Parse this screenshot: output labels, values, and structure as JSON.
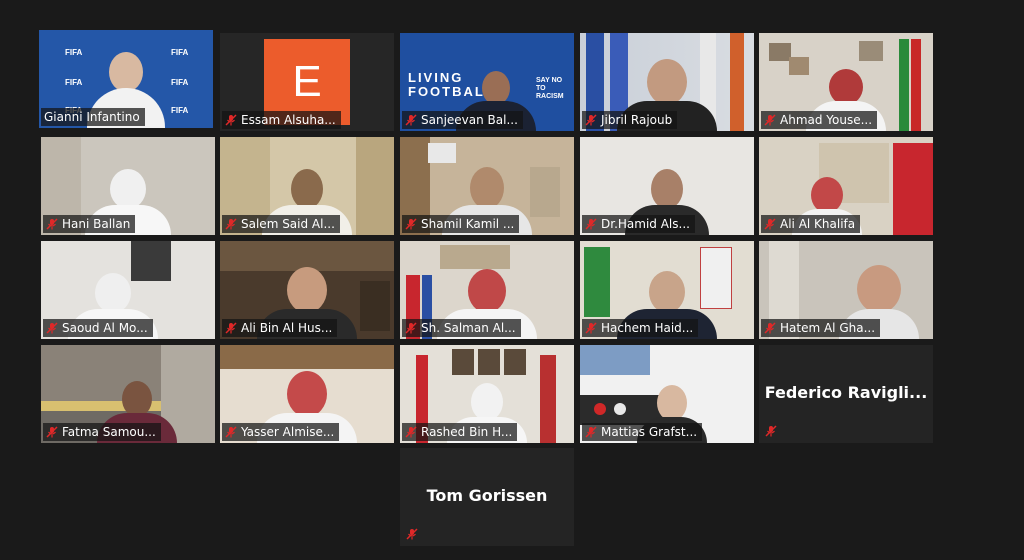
{
  "meeting": {
    "participants": [
      {
        "name": "Gianni Infantino",
        "muted": false,
        "speaking": true
      },
      {
        "name": "Essam Alsuha...",
        "muted": true,
        "avatar_letter": "E",
        "avatar_color": "#ec5c2c"
      },
      {
        "name": "Sanjeevan Bal...",
        "muted": true
      },
      {
        "name": "Jibril Rajoub",
        "muted": true
      },
      {
        "name": "Ahmad Youse...",
        "muted": true
      },
      {
        "name": "Hani Ballan",
        "muted": true
      },
      {
        "name": "Salem Said Al...",
        "muted": true
      },
      {
        "name": "Shamil Kamil ...",
        "muted": true
      },
      {
        "name": "Dr.Hamid Als...",
        "muted": true
      },
      {
        "name": "Ali Al Khalifa",
        "muted": true
      },
      {
        "name": "Saoud Al Mo...",
        "muted": true
      },
      {
        "name": "Ali Bin Al Hus...",
        "muted": true
      },
      {
        "name": "Sh. Salman Al...",
        "muted": true
      },
      {
        "name": "Hachem Haid...",
        "muted": true
      },
      {
        "name": "Hatem Al Gha...",
        "muted": true
      },
      {
        "name": "Fatma Samou...",
        "muted": true
      },
      {
        "name": "Yasser Almise...",
        "muted": true
      },
      {
        "name": "Rashed Bin H...",
        "muted": true
      },
      {
        "name": "Mattias Grafst...",
        "muted": true
      },
      {
        "name": "Federico  Ravigli...",
        "muted": true,
        "video_off": true
      },
      {
        "name": "Tom Gorissen",
        "muted": true,
        "video_off": true
      }
    ]
  },
  "backdrop": {
    "fifa_logo": "FIFA",
    "living_football_line1": "LIVING",
    "living_football_line2": "FOOTBALL",
    "say_no_to_racism_1": "SAY NO",
    "say_no_to_racism_2": "TO RACISM"
  },
  "colors": {
    "active_speaker": "#a8e04a",
    "muted_icon": "#e02828",
    "background": "#1a1a1a",
    "avatar_orange": "#ec5c2c",
    "fifa_blue": "#1f4fa0"
  }
}
